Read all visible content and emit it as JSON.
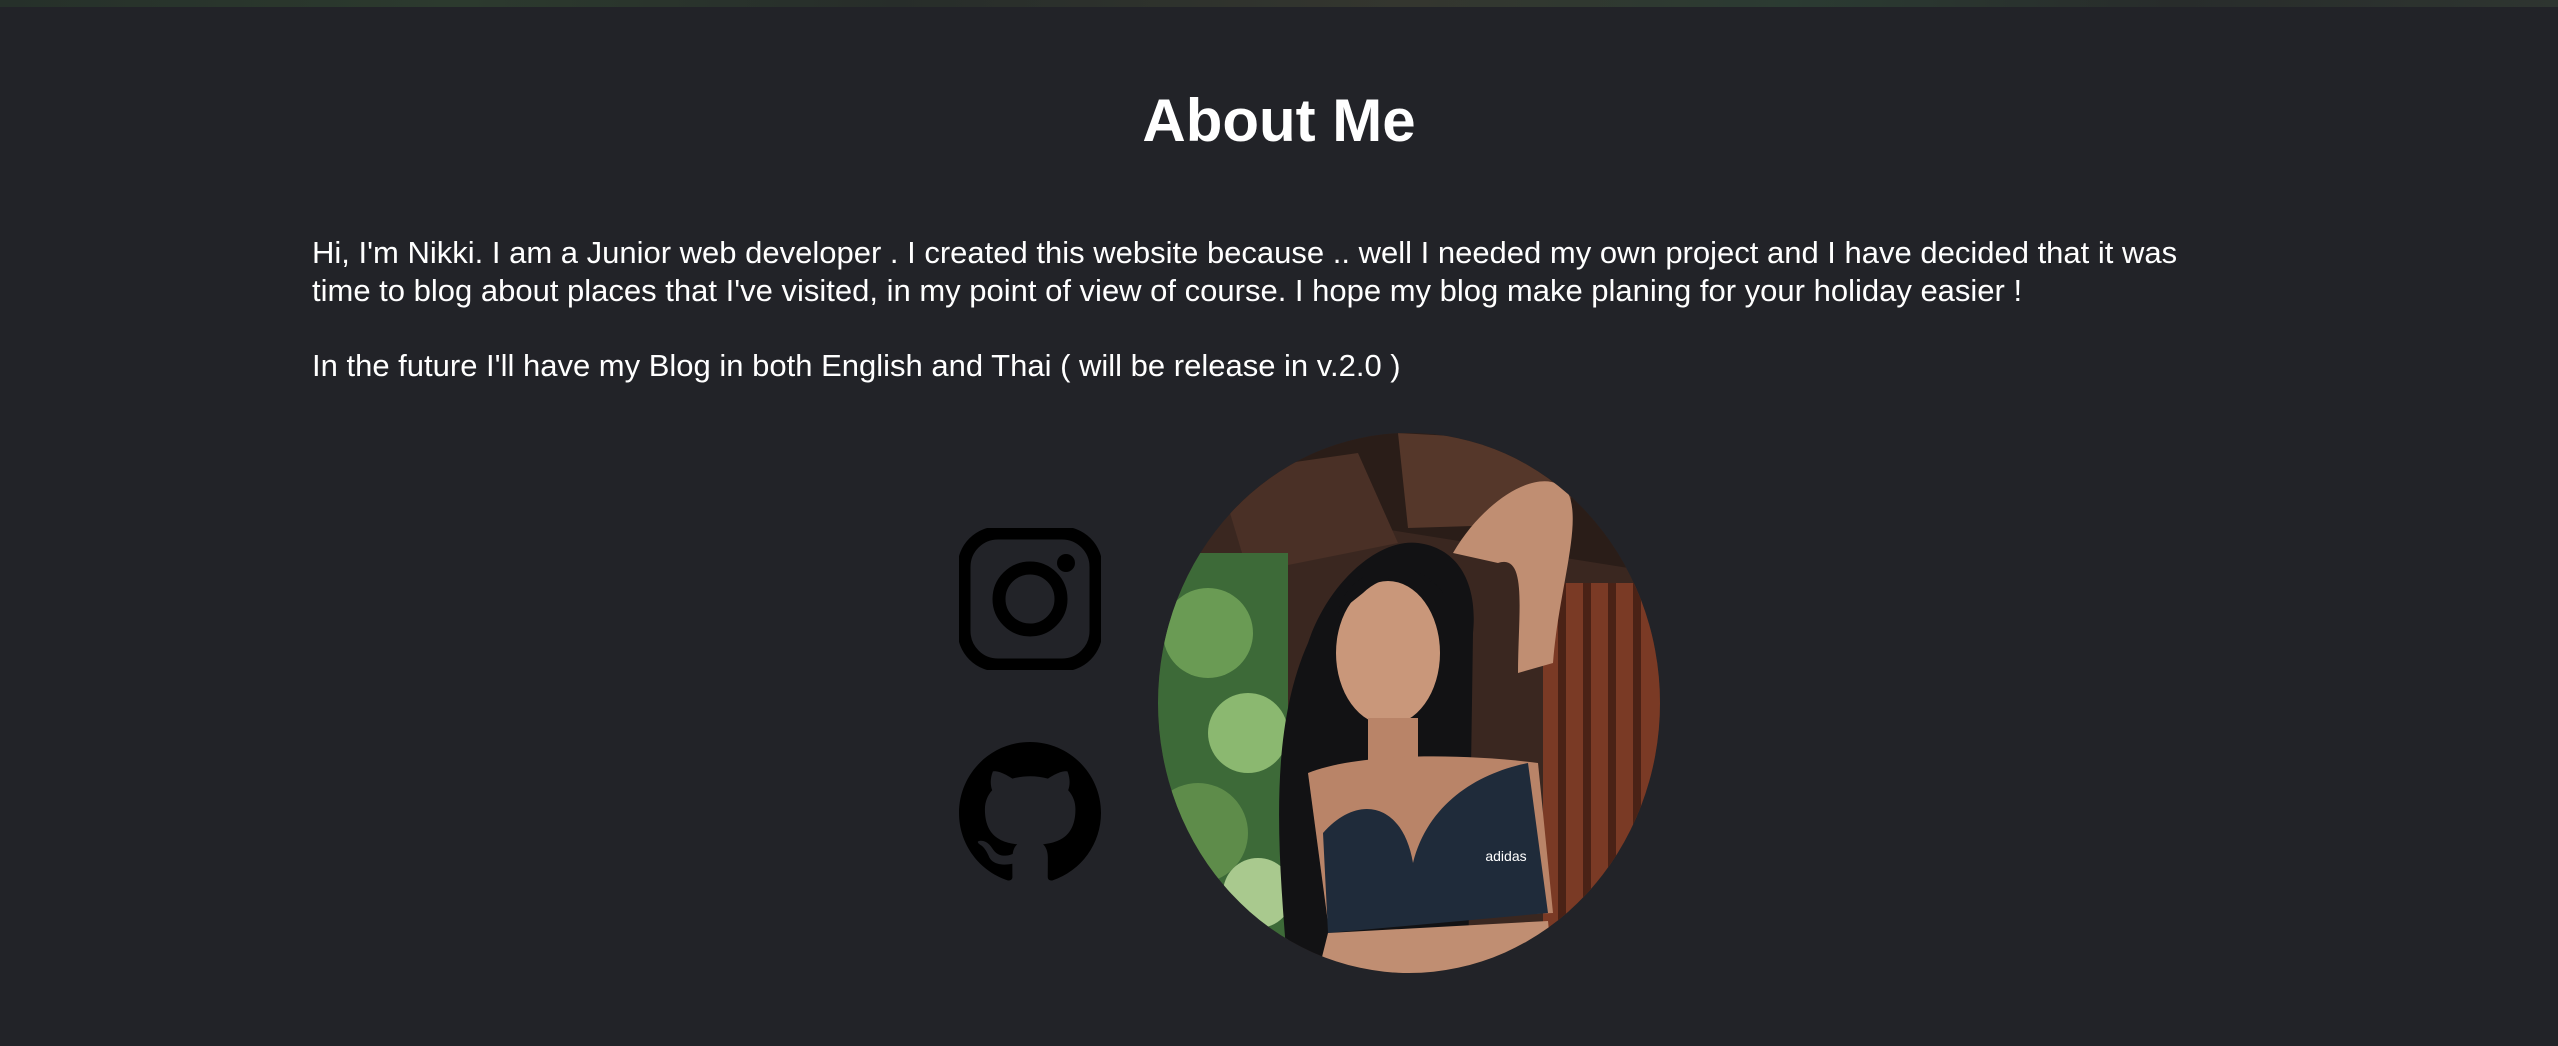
{
  "page": {
    "title": "About Me",
    "paragraph_1": "Hi, I'm Nikki. I am a Junior web developer . I created this website because .. well I needed my own project and I have decided that it was time to blog about places that I've visited, in my point of view of course. I hope my blog make planing for your holiday easier !",
    "paragraph_2": "In the future I'll have my Blog in both English and Thai ( will be release in v.2.0 )"
  },
  "social": {
    "instagram_icon": "instagram-icon",
    "github_icon": "github-icon"
  },
  "profile_photo": {
    "shirt_brand": "adidas"
  },
  "colors": {
    "background": "#222328",
    "text": "#ffffff",
    "icon": "#000000"
  }
}
